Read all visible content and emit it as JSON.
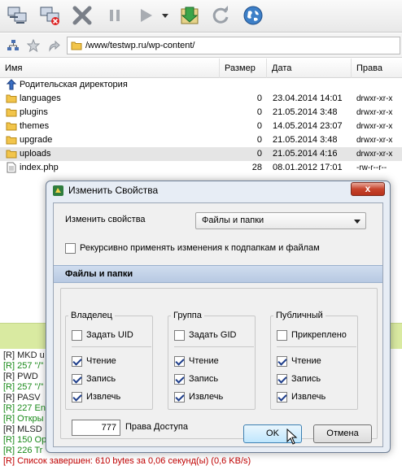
{
  "toolbar": {
    "buttons": [
      {
        "name": "connect-icon"
      },
      {
        "name": "disconnect-icon"
      },
      {
        "name": "stop-icon"
      },
      {
        "name": "pause-icon"
      },
      {
        "name": "play-icon"
      },
      {
        "name": "dropdown-arrow-icon"
      },
      {
        "name": "sync-icon"
      },
      {
        "name": "refresh-icon"
      },
      {
        "name": "globe-icon"
      }
    ]
  },
  "address": {
    "path": "/www/testwp.ru/wp-content/"
  },
  "filelist": {
    "columns": [
      "Имя",
      "Размер",
      "Дата",
      "Права"
    ],
    "parent_label": "Родительская директория",
    "rows": [
      {
        "name": "languages",
        "size": "0",
        "date": "23.04.2014 14:01",
        "perm": "drwxr-xr-x",
        "type": "folder"
      },
      {
        "name": "plugins",
        "size": "0",
        "date": "21.05.2014 3:48",
        "perm": "drwxr-xr-x",
        "type": "folder"
      },
      {
        "name": "themes",
        "size": "0",
        "date": "14.05.2014 23:07",
        "perm": "drwxr-xr-x",
        "type": "folder"
      },
      {
        "name": "upgrade",
        "size": "0",
        "date": "21.05.2014 3:48",
        "perm": "drwxr-xr-x",
        "type": "folder"
      },
      {
        "name": "uploads",
        "size": "0",
        "date": "21.05.2014 4:16",
        "perm": "drwxr-xr-x",
        "type": "folder"
      },
      {
        "name": "index.php",
        "size": "28",
        "date": "08.01.2012 17:01",
        "perm": "-rw-r--r--",
        "type": "file"
      }
    ]
  },
  "log": {
    "lines": [
      {
        "text": "[R] MKD u",
        "color": "black"
      },
      {
        "text": "[R] 257 \"/\"",
        "color": "green"
      },
      {
        "text": "[R] PWD",
        "color": "black"
      },
      {
        "text": "[R] 257 \"/\"",
        "color": "green"
      },
      {
        "text": "[R] PASV",
        "color": "black"
      },
      {
        "text": "[R] 227 En",
        "color": "green"
      },
      {
        "text": "[R] Откры",
        "color": "green"
      },
      {
        "text": "[R] MLSD",
        "color": "black"
      },
      {
        "text": "[R] 150 Op",
        "color": "green"
      },
      {
        "text": "[R] 226 Tr",
        "color": "green"
      },
      {
        "text": "[R] Список завершен: 610 bytes за 0,06 секунд(ы) (0,6 KB/s)",
        "color": "red"
      }
    ]
  },
  "dialog": {
    "title": "Изменить Свойства",
    "close_label": "x",
    "change_label": "Изменить свойства",
    "combo_value": "Файлы и папки",
    "recursive_label": "Рекурсивно применять изменения к подпапкам и файлам",
    "recursive_checked": false,
    "section_title": "Файлы и папки",
    "groups": [
      {
        "title": "Владелец",
        "special": "Задать UID",
        "special_checked": false,
        "read": "Чтение",
        "write": "Запись",
        "exec": "Извлечь"
      },
      {
        "title": "Группа",
        "special": "Задать GID",
        "special_checked": false,
        "read": "Чтение",
        "write": "Запись",
        "exec": "Извлечь"
      },
      {
        "title": "Публичный",
        "special": "Прикреплено",
        "special_checked": false,
        "read": "Чтение",
        "write": "Запись",
        "exec": "Извлечь"
      }
    ],
    "perm_value": "777",
    "perm_label": "Права Доступа",
    "ok_label": "OK",
    "cancel_label": "Отмена"
  }
}
